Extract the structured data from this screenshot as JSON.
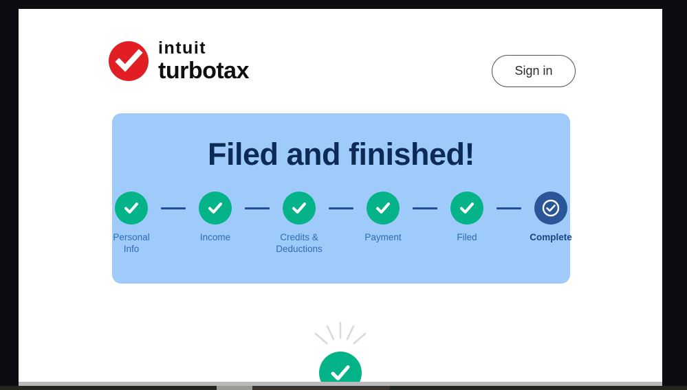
{
  "brand": {
    "mark_icon": "turbotax-check-logo",
    "mark_color": "#e01e24",
    "line1": "intuit",
    "line2": "turbotax"
  },
  "header": {
    "signin_label": "Sign in"
  },
  "card": {
    "title": "Filed and finished!",
    "background_color": "#9fcbfb",
    "title_color": "#0d2a54"
  },
  "stepper": {
    "done_color": "#04b388",
    "current_color": "#2a5699",
    "connector_color": "#1f4e96",
    "label_color": "#2f6bb0",
    "current_label_color": "#1a4480",
    "steps": [
      {
        "label": "Personal\nInfo",
        "state": "done",
        "icon": "check-icon"
      },
      {
        "label": "Income",
        "state": "done",
        "icon": "check-icon"
      },
      {
        "label": "Credits &\nDeductions",
        "state": "done",
        "icon": "check-icon"
      },
      {
        "label": "Payment",
        "state": "done",
        "icon": "check-icon"
      },
      {
        "label": "Filed",
        "state": "done",
        "icon": "check-icon"
      },
      {
        "label": "Complete",
        "state": "current",
        "icon": "check-circle-ring-icon"
      }
    ]
  },
  "celebration": {
    "icon": "success-check-burst-icon",
    "check_color": "#04b388",
    "sparkle_color": "#d9dcd4"
  }
}
